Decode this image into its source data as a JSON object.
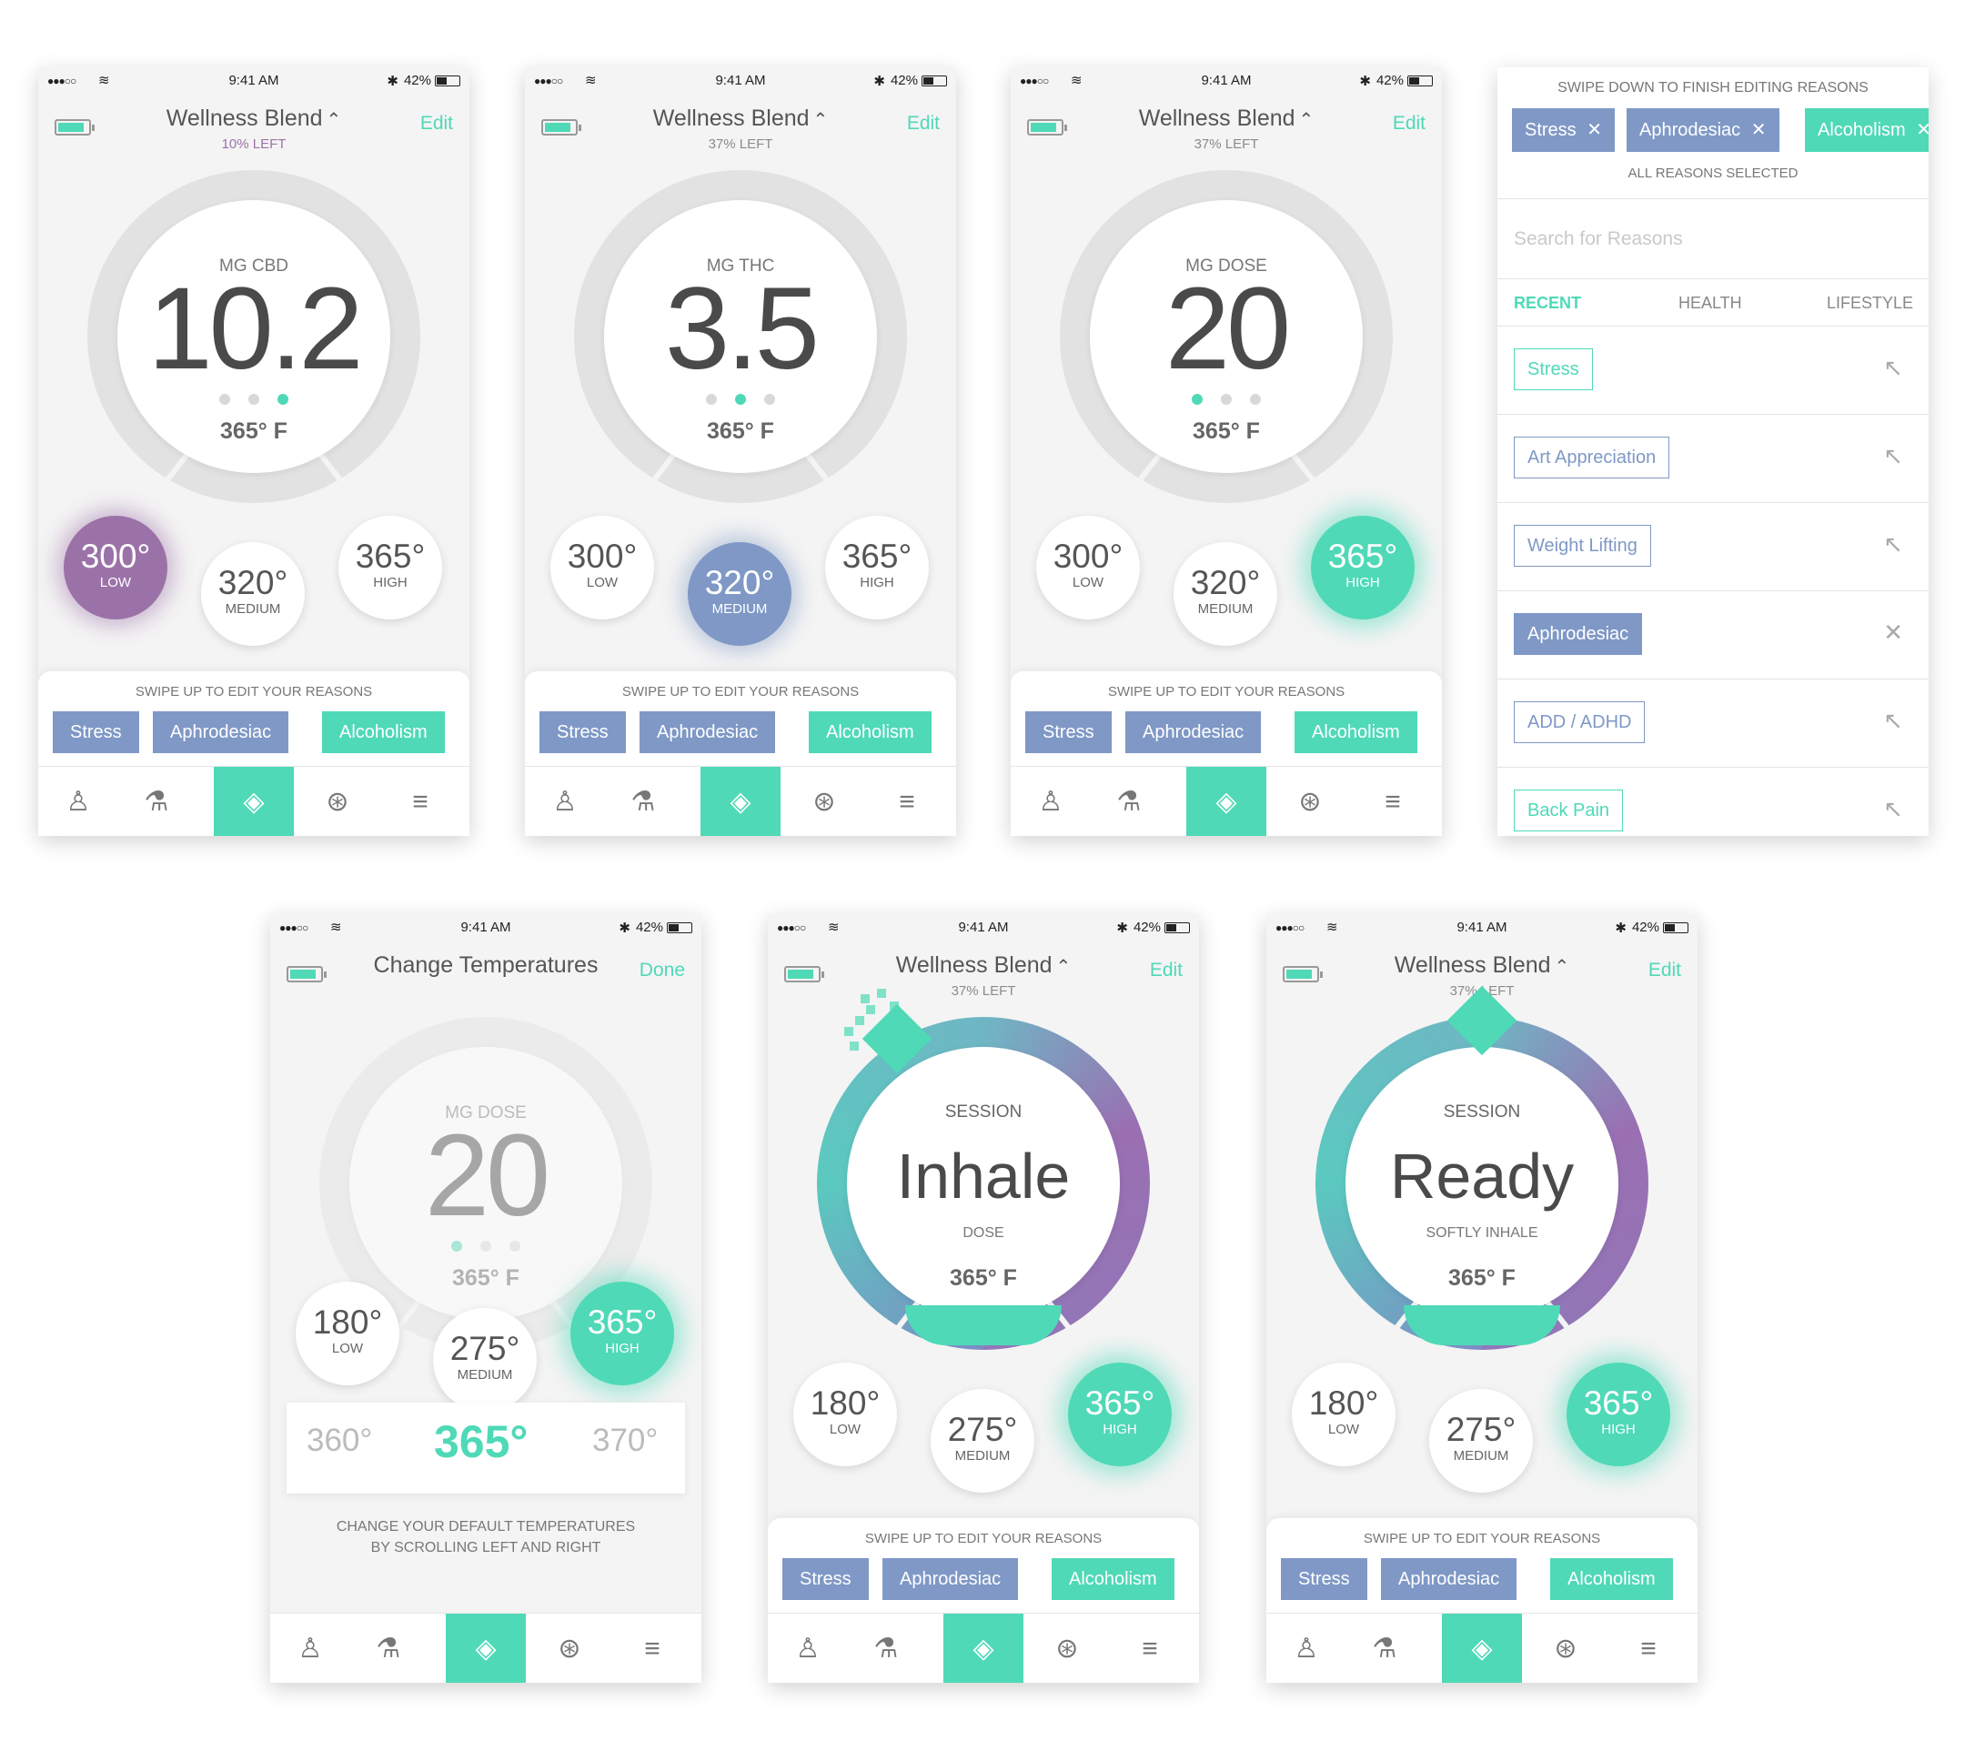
{
  "status": {
    "time": "9:41 AM",
    "battery": "42%",
    "signal": "●●●○○",
    "wifi": "≋",
    "bt": "✱"
  },
  "common": {
    "swipe_hint": "SWIPE UP TO EDIT YOUR REASONS",
    "reasons": [
      "Stress",
      "Aphrodesiac",
      "Alcoholism"
    ],
    "edit": "Edit",
    "unit_f": "365° F",
    "caret": "⌃"
  },
  "tabs": [
    {
      "icon": "user-icon",
      "glyph": "♙"
    },
    {
      "icon": "flask-icon",
      "glyph": "⚗"
    },
    {
      "icon": "pills-icon",
      "glyph": "◈"
    },
    {
      "icon": "lifebuoy-icon",
      "glyph": "⊛"
    },
    {
      "icon": "sliders-icon",
      "glyph": "≡"
    }
  ],
  "screen1": {
    "title": "Wellness Blend",
    "sub": "10% LEFT",
    "unit": "MG CBD",
    "value": "10.2",
    "temps": [
      {
        "t": "300°",
        "l": "LOW"
      },
      {
        "t": "320°",
        "l": "MEDIUM"
      },
      {
        "t": "365°",
        "l": "HIGH"
      }
    ]
  },
  "screen2": {
    "title": "Wellness Blend",
    "sub": "37% LEFT",
    "unit": "MG THC",
    "value": "3.5",
    "temps": [
      {
        "t": "300°",
        "l": "LOW"
      },
      {
        "t": "320°",
        "l": "MEDIUM"
      },
      {
        "t": "365°",
        "l": "HIGH"
      }
    ]
  },
  "screen3": {
    "title": "Wellness Blend",
    "sub": "37% LEFT",
    "unit": "MG DOSE",
    "value": "20",
    "temps": [
      {
        "t": "300°",
        "l": "LOW"
      },
      {
        "t": "320°",
        "l": "MEDIUM"
      },
      {
        "t": "365°",
        "l": "HIGH"
      }
    ]
  },
  "screen4": {
    "swipe": "SWIPE DOWN TO FINISH EDITING REASONS",
    "selected": [
      "Stress",
      "Aphrodesiac",
      "Alcoholism"
    ],
    "remove": "✕",
    "all": "ALL REASONS SELECTED",
    "search": "Search for Reasons",
    "cats": [
      "RECENT",
      "HEALTH",
      "LIFESTYLE"
    ],
    "rows": [
      "Stress",
      "Art Appreciation",
      "Weight Lifting",
      "Aphrodesiac",
      "ADD / ADHD",
      "Back Pain"
    ],
    "add_glyph": "↖",
    "remove_glyph": "✕"
  },
  "screen5": {
    "title": "Change Temperatures",
    "done": "Done",
    "unit": "MG DOSE",
    "value": "20",
    "temps": [
      {
        "t": "180°",
        "l": "LOW"
      },
      {
        "t": "275°",
        "l": "MEDIUM"
      },
      {
        "t": "365°",
        "l": "HIGH"
      }
    ],
    "picker": [
      "360°",
      "365°",
      "370°"
    ],
    "info1": "CHANGE YOUR DEFAULT TEMPERATURES",
    "info2": "BY SCROLLING LEFT AND RIGHT"
  },
  "screen6": {
    "title": "Wellness Blend",
    "sub": "37% LEFT",
    "session": "SESSION",
    "word": "Inhale",
    "small": "DOSE",
    "temps": [
      {
        "t": "180°",
        "l": "LOW"
      },
      {
        "t": "275°",
        "l": "MEDIUM"
      },
      {
        "t": "365°",
        "l": "HIGH"
      }
    ]
  },
  "screen7": {
    "title": "Wellness Blend",
    "sub": "37% LEFT",
    "session": "SESSION",
    "word": "Ready",
    "small": "SOFTLY INHALE",
    "temps": [
      {
        "t": "180°",
        "l": "LOW"
      },
      {
        "t": "275°",
        "l": "MEDIUM"
      },
      {
        "t": "365°",
        "l": "HIGH"
      }
    ]
  },
  "colors": {
    "teal": "#4fd9b7",
    "blue": "#7f98c6",
    "purple": "#9b72a8",
    "text": "#4a4a4a"
  }
}
